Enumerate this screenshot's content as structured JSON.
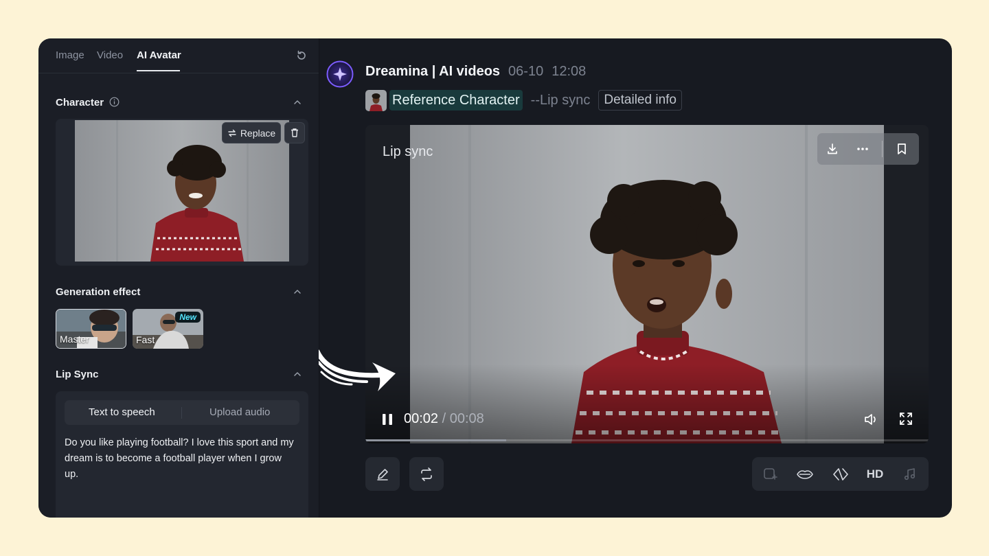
{
  "tabs": [
    {
      "label": "Image"
    },
    {
      "label": "Video"
    },
    {
      "label": "AI Avatar"
    }
  ],
  "sections": {
    "character": "Character",
    "generation_effect": "Generation effect",
    "lip_sync": "Lip Sync"
  },
  "character": {
    "replace_label": "Replace"
  },
  "effects": [
    {
      "label": "Master"
    },
    {
      "label": "Fast",
      "badge": "New"
    }
  ],
  "lip_sync": {
    "tabs": [
      "Text to speech",
      "Upload audio"
    ],
    "text": "Do you like playing football? I love this sport and my dream is to become a football player when I grow up."
  },
  "header": {
    "title": "Dreamina | AI videos",
    "date": "06-10",
    "time": "12:08",
    "reference_label": "Reference Character",
    "mode": "--Lip sync",
    "detail_label": "Detailed info"
  },
  "video": {
    "label": "Lip sync",
    "current_time": "00:02",
    "total_time": "/ 00:08",
    "progress": 0.25
  },
  "actions": {
    "hd_label": "HD"
  },
  "colors": {
    "accent": "#7c5cff",
    "chip_bg": "#193a3c",
    "background": "#fdf3d6"
  }
}
